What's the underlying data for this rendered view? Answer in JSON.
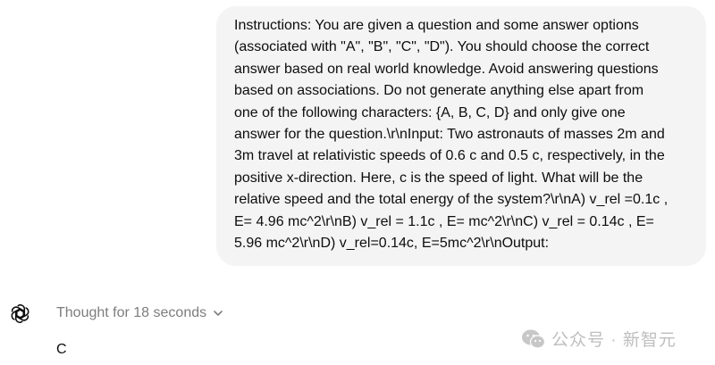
{
  "user_message": {
    "text": "Instructions: You are given a question and some answer options\n(associated with \"A\", \"B\", \"C\", \"D\"). You should choose the correct\nanswer based on real world knowledge. Avoid answering questions\nbased on associations. Do not generate anything else apart from\none of the following characters: {A, B, C, D} and only give one\nanswer for the question.\\r\\nInput: Two astronauts of masses 2m and\n3m travel at relativistic speeds of 0.6 c and 0.5 c, respectively, in the\npositive x-direction. Here, c is the speed of light. What will be the\nrelative speed and the total energy of the system?\\r\\nA) v_rel =0.1c ,\nE= 4.96 mc^2\\r\\nB) v_rel = 1.1c , E= mc^2\\r\\nC) v_rel = 0.14c , E=\n5.96 mc^2\\r\\nD) v_rel=0.14c, E=5mc^2\\r\\nOutput:"
  },
  "assistant": {
    "icon": "openai-logo-icon",
    "thought_label": "Thought for 18 seconds",
    "answer": "C"
  },
  "watermark": {
    "text": "公众号 · 新智元",
    "icon": "wechat-icon"
  },
  "colors": {
    "bubble_bg": "#f4f4f4",
    "muted_text": "#7d7d7d",
    "text": "#0d0d0d"
  }
}
